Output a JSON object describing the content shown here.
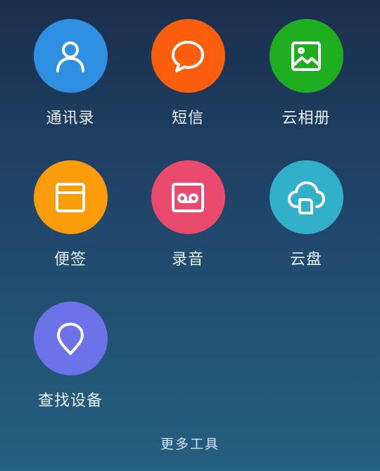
{
  "apps": [
    {
      "label": "通讯录",
      "icon": "contacts-icon",
      "color": "#2f8fe0"
    },
    {
      "label": "短信",
      "icon": "message-icon",
      "color": "#fb5e0d"
    },
    {
      "label": "云相册",
      "icon": "gallery-icon",
      "color": "#1fae1f"
    },
    {
      "label": "便签",
      "icon": "notes-icon",
      "color": "#fb9c0a"
    },
    {
      "label": "录音",
      "icon": "recorder-icon",
      "color": "#ea4a6e"
    },
    {
      "label": "云盘",
      "icon": "cloud-drive-icon",
      "color": "#33b0c9"
    },
    {
      "label": "查找设备",
      "icon": "location-pin-icon",
      "color": "#6c73e9"
    }
  ],
  "footer": {
    "more_tools_label": "更多工具"
  }
}
